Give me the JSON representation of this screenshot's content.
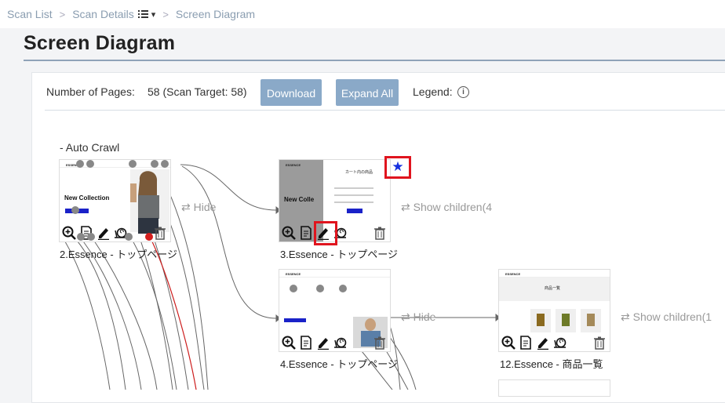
{
  "breadcrumb": {
    "items": [
      "Scan List",
      "Scan Details",
      "Screen Diagram"
    ],
    "separator": ">"
  },
  "page_title": "Screen Diagram",
  "toolbar": {
    "pages_label": "Number of Pages:",
    "pages_value": "58 (Scan Target: 58)",
    "download_label": "Download",
    "expand_all_label": "Expand All",
    "legend_label": "Legend:"
  },
  "diagram": {
    "section_label": "- Auto Crawl",
    "nodes": [
      {
        "label": "2.Essence - トップページ",
        "hero_text": "New Collection",
        "logo": "ESSENCE"
      },
      {
        "label": "3.Essence - トップページ",
        "hero_text": "New Colle",
        "logo": "ESSENCE",
        "cart_text": "カート内の商品"
      },
      {
        "label": "4.Essence - トップページ",
        "logo": "ESSENCE"
      },
      {
        "label": "12.Essence - 商品一覧",
        "logo": "ESSENCE",
        "list_title": "商品一覧"
      }
    ],
    "toggles": {
      "hide": "Hide",
      "show_children_4": "Show children(4",
      "show_children_1": "Show children(1"
    }
  },
  "colors": {
    "accent_button": "#8aa9c8",
    "link": "#6b8fb5",
    "highlight": "#e0141e",
    "star": "#1530e0"
  },
  "icons": [
    "zoom-in-icon",
    "document-icon",
    "pencil-icon",
    "snail-icon",
    "trash-icon",
    "star-icon",
    "swap-arrows-icon",
    "info-icon",
    "list-icon",
    "chevron-right-icon"
  ]
}
